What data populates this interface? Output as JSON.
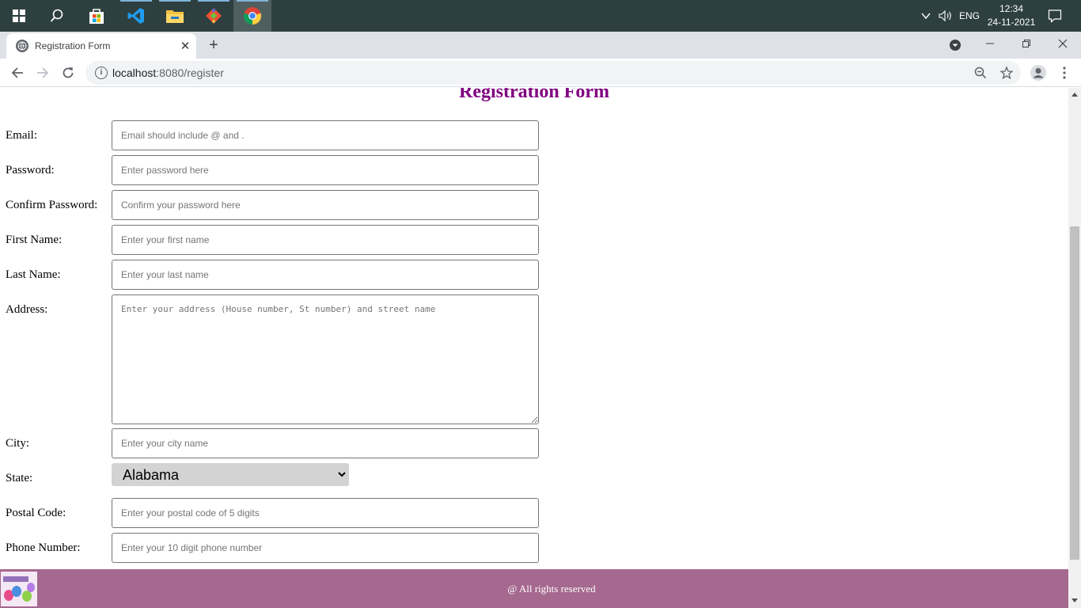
{
  "taskbar": {
    "apps": [
      "start",
      "search",
      "store",
      "vscode",
      "file-explorer",
      "git",
      "chrome"
    ],
    "tray": {
      "language": "ENG",
      "time": "12:34",
      "date": "24-11-2021"
    }
  },
  "browser": {
    "tab_title": "Registration Form",
    "url_host": "localhost",
    "url_path": ":8080/register"
  },
  "page": {
    "title": "Registration Form",
    "fields": {
      "email": {
        "label": "Email:",
        "placeholder": "Email should include @ and ."
      },
      "password": {
        "label": "Password:",
        "placeholder": "Enter password here"
      },
      "confirm_password": {
        "label": "Confirm Password:",
        "placeholder": "Confirm your password here"
      },
      "first_name": {
        "label": "First Name:",
        "placeholder": "Enter your first name"
      },
      "last_name": {
        "label": "Last Name:",
        "placeholder": "Enter your last name"
      },
      "address": {
        "label": "Address:",
        "placeholder": "Enter your address (House number, St number) and street name"
      },
      "city": {
        "label": "City:",
        "placeholder": "Enter your city name"
      },
      "state": {
        "label": "State:",
        "selected": "Alabama"
      },
      "postal_code": {
        "label": "Postal Code:",
        "placeholder": "Enter your postal code of 5 digits"
      },
      "phone": {
        "label": "Phone Number:",
        "placeholder": "Enter your 10 digit phone number"
      }
    },
    "footer_text": "@ All rights reserved"
  },
  "colors": {
    "title": "#800080",
    "footer": "#a5688f",
    "taskbar": "#2e3f3f"
  }
}
